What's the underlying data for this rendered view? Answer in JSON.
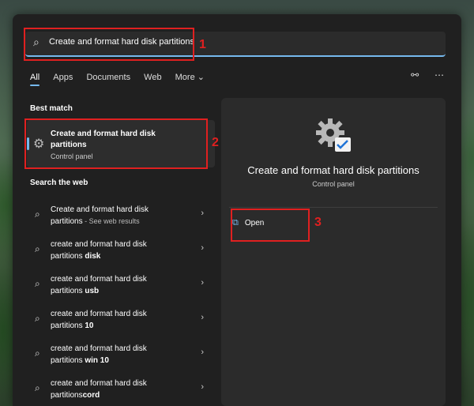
{
  "search": {
    "value": "Create and format hard disk partitions"
  },
  "tabs": [
    "All",
    "Apps",
    "Documents",
    "Web",
    "More ⌄"
  ],
  "sections": {
    "best_match": "Best match",
    "search_web": "Search the web"
  },
  "best_match": {
    "title": "Create and format hard disk partitions",
    "subtitle": "Control panel"
  },
  "web_results": [
    {
      "line1": "Create and format hard disk",
      "line2": "partitions",
      "hint": " - See web results",
      "bold": ""
    },
    {
      "line1": "create and format hard disk",
      "line2": "partitions ",
      "hint": "",
      "bold": "disk"
    },
    {
      "line1": "create and format hard disk",
      "line2": "partitions ",
      "hint": "",
      "bold": "usb"
    },
    {
      "line1": "create and format hard disk",
      "line2": "partitions ",
      "hint": "",
      "bold": "10"
    },
    {
      "line1": "create and format hard disk",
      "line2": "partitions ",
      "hint": "",
      "bold": "win 10"
    },
    {
      "line1": "create and format hard disk",
      "line2": "partitions",
      "hint": "",
      "bold": "cord"
    }
  ],
  "preview": {
    "title": "Create and format hard disk partitions",
    "subtitle": "Control panel",
    "open_label": "Open"
  },
  "annotations": [
    "1",
    "2",
    "3"
  ],
  "colors": {
    "accent": "#76b9ed",
    "annotation": "#e02020"
  }
}
